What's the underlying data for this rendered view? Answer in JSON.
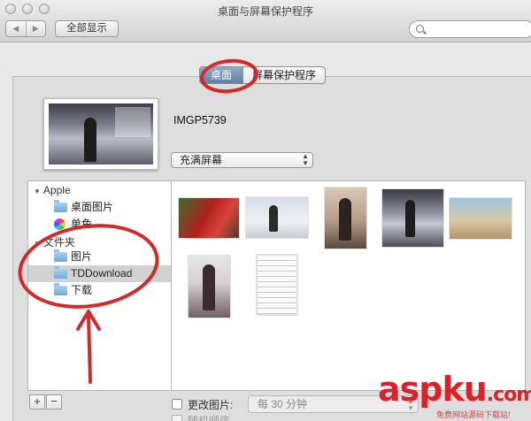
{
  "window": {
    "title": "桌面与屏幕保护程序"
  },
  "toolbar": {
    "back_label": "◀",
    "forward_label": "▶",
    "show_all_label": "全部显示",
    "search_placeholder": ""
  },
  "tabs": [
    {
      "label": "桌面",
      "active": true
    },
    {
      "label": "屏幕保护程序",
      "active": false
    }
  ],
  "preview": {
    "image_name": "IMGP5739",
    "fit_option": "充满屏幕"
  },
  "sidebar": {
    "groups": [
      {
        "label": "Apple",
        "items": [
          {
            "label": "桌面图片",
            "icon": "folder-icon"
          },
          {
            "label": "单色",
            "icon": "color-wheel-icon"
          }
        ]
      },
      {
        "label": "文件夹",
        "items": [
          {
            "label": "图片",
            "icon": "folder-icon"
          },
          {
            "label": "TDDownload",
            "icon": "folder-icon",
            "selected": true
          },
          {
            "label": "下载",
            "icon": "folder-icon"
          }
        ]
      }
    ],
    "add_label": "+",
    "remove_label": "−"
  },
  "bottom": {
    "change_picture_label": "更改图片:",
    "interval_label": "每 30 分钟",
    "random_label": "随机顺序"
  },
  "watermark": {
    "text": "aspku",
    "suffix": ".com",
    "subtitle": "免费网站源码下载站!"
  },
  "colors": {
    "annotation": "#d22a2a",
    "selection": "#d2d2d2",
    "tab_active": "#6f8db5"
  }
}
